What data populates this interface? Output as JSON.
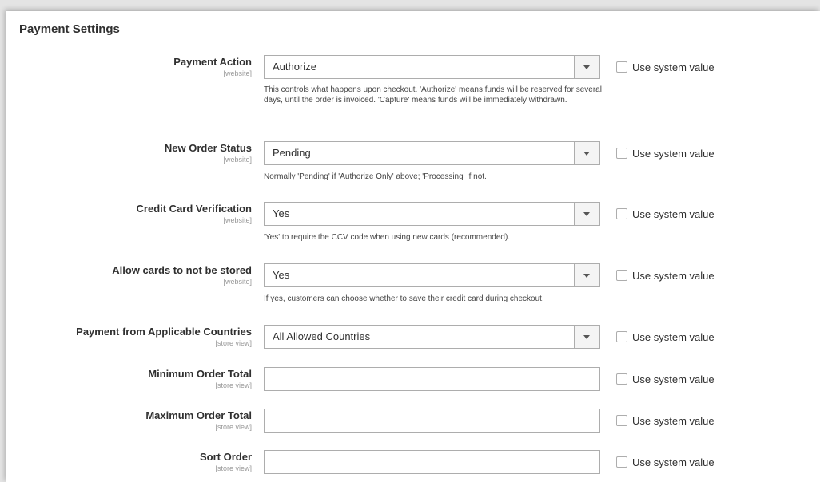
{
  "section": {
    "title": "Payment Settings"
  },
  "use_system_value_label": "Use system value",
  "fields": [
    {
      "label": "Payment Action",
      "scope": "[website]",
      "type": "select",
      "value": "Authorize",
      "note": "This controls what happens upon checkout. 'Authorize' means funds will be reserved for several days, until the order is invoiced. 'Capture' means funds will be immediately withdrawn."
    },
    {
      "label": "New Order Status",
      "scope": "[website]",
      "type": "select",
      "value": "Pending",
      "note": "Normally 'Pending' if 'Authorize Only' above; 'Processing' if not."
    },
    {
      "label": "Credit Card Verification",
      "scope": "[website]",
      "type": "select",
      "value": "Yes",
      "note": "'Yes' to require the CCV code when using new cards (recommended)."
    },
    {
      "label": "Allow cards to not be stored",
      "scope": "[website]",
      "type": "select",
      "value": "Yes",
      "note": "If yes, customers can choose whether to save their credit card during checkout."
    },
    {
      "label": "Payment from Applicable Countries",
      "scope": "[store view]",
      "type": "select",
      "value": "All Allowed Countries",
      "note": ""
    },
    {
      "label": "Minimum Order Total",
      "scope": "[store view]",
      "type": "text",
      "value": "",
      "note": ""
    },
    {
      "label": "Maximum Order Total",
      "scope": "[store view]",
      "type": "text",
      "value": "",
      "note": ""
    },
    {
      "label": "Sort Order",
      "scope": "[store view]",
      "type": "text",
      "value": "",
      "note": ""
    }
  ]
}
